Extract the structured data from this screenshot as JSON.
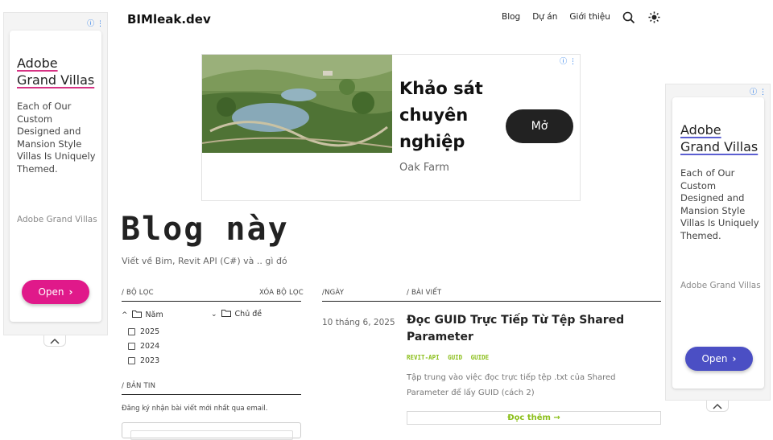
{
  "header": {
    "logo": "BIMleak.dev",
    "nav": [
      "Blog",
      "Dự án",
      "Giới thiệu"
    ]
  },
  "left_ad": {
    "title_line1": "Adobe",
    "title_line2": "Grand Villas",
    "description": "Each of Our Custom Designed and Mansion Style Villas Is Uniquely Themed.",
    "brand": "Adobe Grand Villas",
    "button": "Open",
    "accent": "#e0198a"
  },
  "right_ad": {
    "title_line1": "Adobe",
    "title_line2": "Grand Villas",
    "description": "Each of Our Custom Designed and Mansion Style Villas Is Uniquely Themed.",
    "brand": "Adobe Grand Villas",
    "button": "Open",
    "accent": "#4b4fc4"
  },
  "banner_ad": {
    "headline_l1": "Khảo sát",
    "headline_l2": "chuyên",
    "headline_l3": "nghiệp",
    "brand": "Oak Farm",
    "button": "Mở"
  },
  "hero": {
    "title": "Blog này",
    "subtitle": "Viết về Bim, Revit API (C#) và .. gì đó"
  },
  "filters": {
    "label": "/ BỘ LỌC",
    "clear": "XÓA BỘ LỌC",
    "year_group": "Năm",
    "topic_group": "Chủ đề",
    "years": [
      "2025",
      "2024",
      "2023"
    ]
  },
  "newsletter": {
    "label": "/ BẢN TIN",
    "text": "Đăng ký nhận bài viết mới nhất qua email."
  },
  "posts_table": {
    "col_date": "/NGÀY",
    "col_post": "/ BÀI VIẾT"
  },
  "post": {
    "date": "10 tháng 6, 2025",
    "title_l1": "Đọc GUID Trực Tiếp Từ Tệp Shared",
    "title_l2": "Parameter",
    "tags": [
      "REVIT-API",
      "GUID",
      "GUIDE"
    ],
    "excerpt_l1": "Tập trung vào việc đọc trực tiếp tệp .txt của Shared",
    "excerpt_l2": "Parameter để lấy GUID (cách 2)",
    "read_more": "Đọc thêm →"
  }
}
